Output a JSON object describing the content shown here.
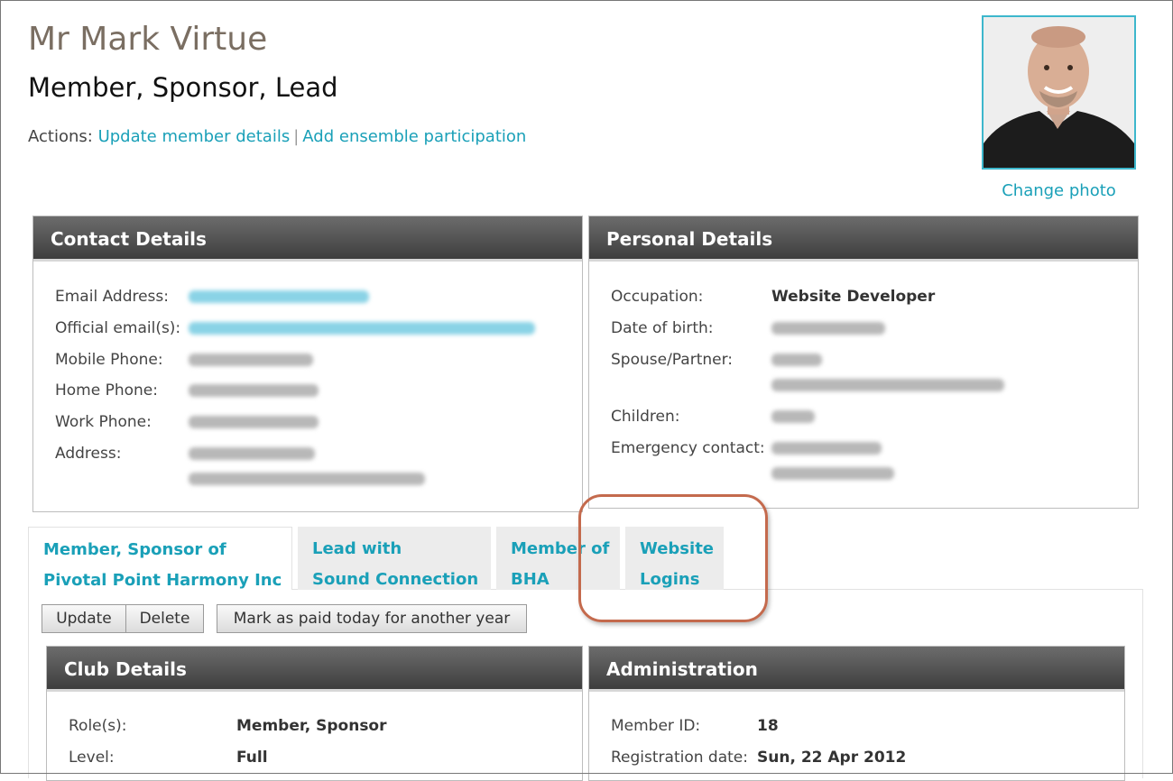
{
  "member": {
    "name": "Mr Mark Virtue",
    "roles": "Member, Sponsor, Lead"
  },
  "actions": {
    "label": "Actions:",
    "update_link": "Update member details",
    "separator": "|",
    "add_link": "Add ensemble participation"
  },
  "photo": {
    "change_label": "Change photo"
  },
  "contact": {
    "title": "Contact Details",
    "rows": [
      {
        "label": "Email Address:"
      },
      {
        "label": "Official email(s):"
      },
      {
        "label": "Mobile Phone:"
      },
      {
        "label": "Home Phone:"
      },
      {
        "label": "Work Phone:"
      },
      {
        "label": "Address:"
      }
    ]
  },
  "personal": {
    "title": "Personal Details",
    "rows": [
      {
        "label": "Occupation:",
        "value": "Website Developer"
      },
      {
        "label": "Date of birth:"
      },
      {
        "label": "Spouse/Partner:"
      },
      {
        "label": "Children:"
      },
      {
        "label": "Emergency contact:"
      }
    ]
  },
  "tabs": [
    {
      "line1": "Member, Sponsor of",
      "line2": "Pivotal Point Harmony Inc"
    },
    {
      "line1": "Lead with",
      "line2": "Sound Connection"
    },
    {
      "line1": "Member of",
      "line2": "BHA"
    },
    {
      "line1": "Website",
      "line2": "Logins"
    }
  ],
  "buttons": {
    "update": "Update",
    "delete": "Delete",
    "mark_paid": "Mark as paid today for another year"
  },
  "club": {
    "title": "Club Details",
    "rows": [
      {
        "label": "Role(s):",
        "value": "Member, Sponsor"
      },
      {
        "label": "Level:",
        "value": "Full"
      }
    ]
  },
  "admin": {
    "title": "Administration",
    "rows": [
      {
        "label": "Member ID:",
        "value": "18"
      },
      {
        "label": "Registration date:",
        "value": "Sun, 22 Apr 2012"
      }
    ]
  },
  "colors": {
    "link": "#1aa0b8",
    "header_bg": "#4e4e4e",
    "highlight": "#c46a4d"
  }
}
